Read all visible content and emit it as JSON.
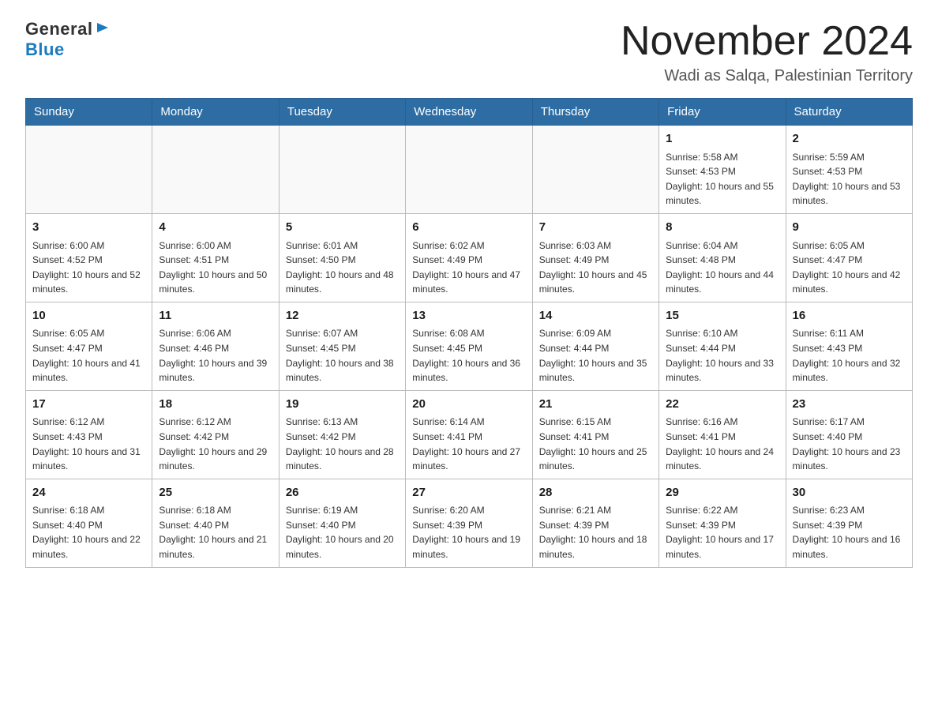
{
  "logo": {
    "general": "General",
    "blue": "Blue"
  },
  "title": "November 2024",
  "location": "Wadi as Salqa, Palestinian Territory",
  "days_of_week": [
    "Sunday",
    "Monday",
    "Tuesday",
    "Wednesday",
    "Thursday",
    "Friday",
    "Saturday"
  ],
  "weeks": [
    [
      {
        "day": "",
        "info": ""
      },
      {
        "day": "",
        "info": ""
      },
      {
        "day": "",
        "info": ""
      },
      {
        "day": "",
        "info": ""
      },
      {
        "day": "",
        "info": ""
      },
      {
        "day": "1",
        "info": "Sunrise: 5:58 AM\nSunset: 4:53 PM\nDaylight: 10 hours and 55 minutes."
      },
      {
        "day": "2",
        "info": "Sunrise: 5:59 AM\nSunset: 4:53 PM\nDaylight: 10 hours and 53 minutes."
      }
    ],
    [
      {
        "day": "3",
        "info": "Sunrise: 6:00 AM\nSunset: 4:52 PM\nDaylight: 10 hours and 52 minutes."
      },
      {
        "day": "4",
        "info": "Sunrise: 6:00 AM\nSunset: 4:51 PM\nDaylight: 10 hours and 50 minutes."
      },
      {
        "day": "5",
        "info": "Sunrise: 6:01 AM\nSunset: 4:50 PM\nDaylight: 10 hours and 48 minutes."
      },
      {
        "day": "6",
        "info": "Sunrise: 6:02 AM\nSunset: 4:49 PM\nDaylight: 10 hours and 47 minutes."
      },
      {
        "day": "7",
        "info": "Sunrise: 6:03 AM\nSunset: 4:49 PM\nDaylight: 10 hours and 45 minutes."
      },
      {
        "day": "8",
        "info": "Sunrise: 6:04 AM\nSunset: 4:48 PM\nDaylight: 10 hours and 44 minutes."
      },
      {
        "day": "9",
        "info": "Sunrise: 6:05 AM\nSunset: 4:47 PM\nDaylight: 10 hours and 42 minutes."
      }
    ],
    [
      {
        "day": "10",
        "info": "Sunrise: 6:05 AM\nSunset: 4:47 PM\nDaylight: 10 hours and 41 minutes."
      },
      {
        "day": "11",
        "info": "Sunrise: 6:06 AM\nSunset: 4:46 PM\nDaylight: 10 hours and 39 minutes."
      },
      {
        "day": "12",
        "info": "Sunrise: 6:07 AM\nSunset: 4:45 PM\nDaylight: 10 hours and 38 minutes."
      },
      {
        "day": "13",
        "info": "Sunrise: 6:08 AM\nSunset: 4:45 PM\nDaylight: 10 hours and 36 minutes."
      },
      {
        "day": "14",
        "info": "Sunrise: 6:09 AM\nSunset: 4:44 PM\nDaylight: 10 hours and 35 minutes."
      },
      {
        "day": "15",
        "info": "Sunrise: 6:10 AM\nSunset: 4:44 PM\nDaylight: 10 hours and 33 minutes."
      },
      {
        "day": "16",
        "info": "Sunrise: 6:11 AM\nSunset: 4:43 PM\nDaylight: 10 hours and 32 minutes."
      }
    ],
    [
      {
        "day": "17",
        "info": "Sunrise: 6:12 AM\nSunset: 4:43 PM\nDaylight: 10 hours and 31 minutes."
      },
      {
        "day": "18",
        "info": "Sunrise: 6:12 AM\nSunset: 4:42 PM\nDaylight: 10 hours and 29 minutes."
      },
      {
        "day": "19",
        "info": "Sunrise: 6:13 AM\nSunset: 4:42 PM\nDaylight: 10 hours and 28 minutes."
      },
      {
        "day": "20",
        "info": "Sunrise: 6:14 AM\nSunset: 4:41 PM\nDaylight: 10 hours and 27 minutes."
      },
      {
        "day": "21",
        "info": "Sunrise: 6:15 AM\nSunset: 4:41 PM\nDaylight: 10 hours and 25 minutes."
      },
      {
        "day": "22",
        "info": "Sunrise: 6:16 AM\nSunset: 4:41 PM\nDaylight: 10 hours and 24 minutes."
      },
      {
        "day": "23",
        "info": "Sunrise: 6:17 AM\nSunset: 4:40 PM\nDaylight: 10 hours and 23 minutes."
      }
    ],
    [
      {
        "day": "24",
        "info": "Sunrise: 6:18 AM\nSunset: 4:40 PM\nDaylight: 10 hours and 22 minutes."
      },
      {
        "day": "25",
        "info": "Sunrise: 6:18 AM\nSunset: 4:40 PM\nDaylight: 10 hours and 21 minutes."
      },
      {
        "day": "26",
        "info": "Sunrise: 6:19 AM\nSunset: 4:40 PM\nDaylight: 10 hours and 20 minutes."
      },
      {
        "day": "27",
        "info": "Sunrise: 6:20 AM\nSunset: 4:39 PM\nDaylight: 10 hours and 19 minutes."
      },
      {
        "day": "28",
        "info": "Sunrise: 6:21 AM\nSunset: 4:39 PM\nDaylight: 10 hours and 18 minutes."
      },
      {
        "day": "29",
        "info": "Sunrise: 6:22 AM\nSunset: 4:39 PM\nDaylight: 10 hours and 17 minutes."
      },
      {
        "day": "30",
        "info": "Sunrise: 6:23 AM\nSunset: 4:39 PM\nDaylight: 10 hours and 16 minutes."
      }
    ]
  ]
}
